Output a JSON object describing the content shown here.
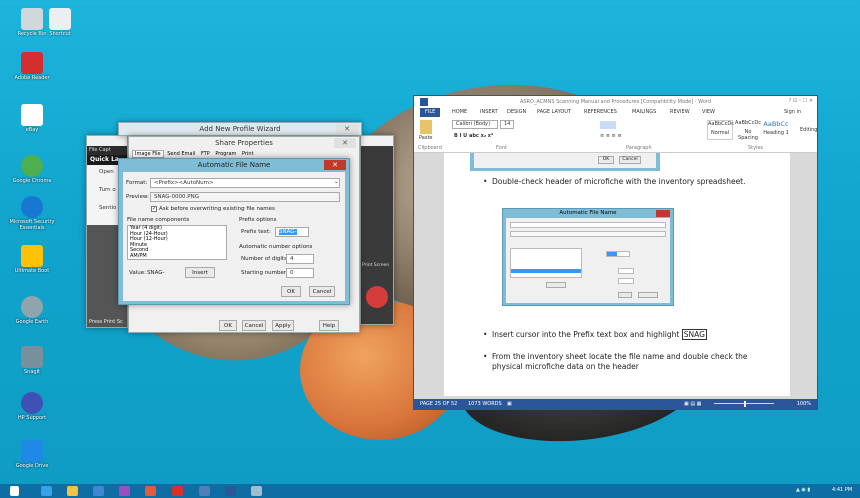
{
  "desktop_icons": [
    {
      "label": "Recycle Bin",
      "color": "#cfd8dc"
    },
    {
      "label": "Shortcut",
      "color": "#eceff1"
    },
    {
      "label": "Adobe Reader",
      "color": "#d32f2f"
    },
    {
      "label": "eBay",
      "color": "#ffffff"
    },
    {
      "label": "Google Chrome",
      "color": "#4caf50"
    },
    {
      "label": "Microsoft Security Essentials",
      "color": "#1976d2"
    },
    {
      "label": "Ultimate Boot",
      "color": "#ffc107"
    },
    {
      "label": "Google Earth",
      "color": "#90a4ae"
    },
    {
      "label": "SnagIt",
      "color": "#78909c"
    },
    {
      "label": "HP Support",
      "color": "#3f51b5"
    },
    {
      "label": "Google Drive",
      "color": "#1e88e5"
    }
  ],
  "wizard": {
    "title": "Add New Profile Wizard",
    "subtitle": "Share Properties",
    "tabs": [
      "Image File",
      "Send Email",
      "FTP",
      "Program",
      "Print"
    ],
    "buttons": {
      "ok": "OK",
      "cancel": "Cancel",
      "apply": "Apply",
      "help": "Help"
    }
  },
  "background_app": {
    "tabs": [
      "File",
      "Capt"
    ],
    "panel_title": "Quick La",
    "items": [
      "Open",
      "Turn o",
      "Sentio"
    ],
    "footer": "Press Print Sc",
    "print_screen": "Print Screen"
  },
  "afn": {
    "title": "Automatic File Name",
    "format_label": "Format:",
    "format_value": "<Prefix><AutoNum>",
    "preview_label": "Preview:",
    "preview_value": "SNAG-0000.PNG",
    "ask_label": "Ask before overwriting existing file names",
    "components_label": "File name components",
    "components": [
      "Year (4 digit)",
      "Hour (24-Hour)",
      "Hour (12-Hour)",
      "Minute",
      "Second",
      "AM/PM"
    ],
    "value_label": "Value:",
    "value": "SNAG-",
    "insert": "Insert",
    "prefix_options_label": "Prefix options",
    "prefix_text_label": "Prefix text:",
    "prefix_text": "SNAG-",
    "auto_options_label": "Automatic number options",
    "digits_label": "Number of digits:",
    "digits": "4",
    "start_label": "Starting number:",
    "start": "0",
    "ok": "OK",
    "cancel": "Cancel"
  },
  "word": {
    "title": "ASRO_ACMNS Scanning Manual and Procedures [Compatibility Mode] - Word",
    "tabs": [
      "FILE",
      "HOME",
      "INSERT",
      "DESIGN",
      "PAGE LAYOUT",
      "REFERENCES",
      "MAILINGS",
      "REVIEW",
      "VIEW"
    ],
    "sign_in": "Sign in",
    "font_name": "Calibri (Body)",
    "font_size": "14",
    "paste": "Paste",
    "groups": [
      "Clipboard",
      "Font",
      "Paragraph",
      "Styles",
      "Editing"
    ],
    "styles": [
      {
        "sample": "AaBbCcDc",
        "name": "Normal"
      },
      {
        "sample": "AaBbCcDc",
        "name": "No Spacing"
      },
      {
        "sample": "AaBbCc",
        "name": "Heading 1"
      }
    ],
    "doc": {
      "top_buttons": {
        "ok": "OK",
        "cancel": "Cancel"
      },
      "bullet1": "Double-check header of microfiche with the inventory spreadsheet.",
      "embedded_title": "Automatic File Name",
      "bullet2_pre": "Insert cursor into the Prefix text box and highlight ",
      "bullet2_highlight": "SNAG",
      "bullet3": "From the inventory sheet locate the file name and double check the physical microfiche data on the header"
    },
    "status": {
      "page": "PAGE 25 OF 52",
      "words": "1073 WORDS",
      "zoom": "100%"
    }
  },
  "taskbar": {
    "apps": [
      {
        "name": "windows",
        "color": "#ffffff"
      },
      {
        "name": "ie",
        "color": "#35a2e8"
      },
      {
        "name": "explorer",
        "color": "#f5c342"
      },
      {
        "name": "media",
        "color": "#3f86d3"
      },
      {
        "name": "onenote",
        "color": "#9b4fbf"
      },
      {
        "name": "chrome",
        "color": "#e45b3b"
      },
      {
        "name": "acrobat",
        "color": "#d8312b"
      },
      {
        "name": "snagit",
        "color": "#4e7fb6"
      },
      {
        "name": "word",
        "color": "#2b579a"
      },
      {
        "name": "other",
        "color": "#9fbfcf"
      }
    ],
    "clock": "4:41 PM"
  }
}
